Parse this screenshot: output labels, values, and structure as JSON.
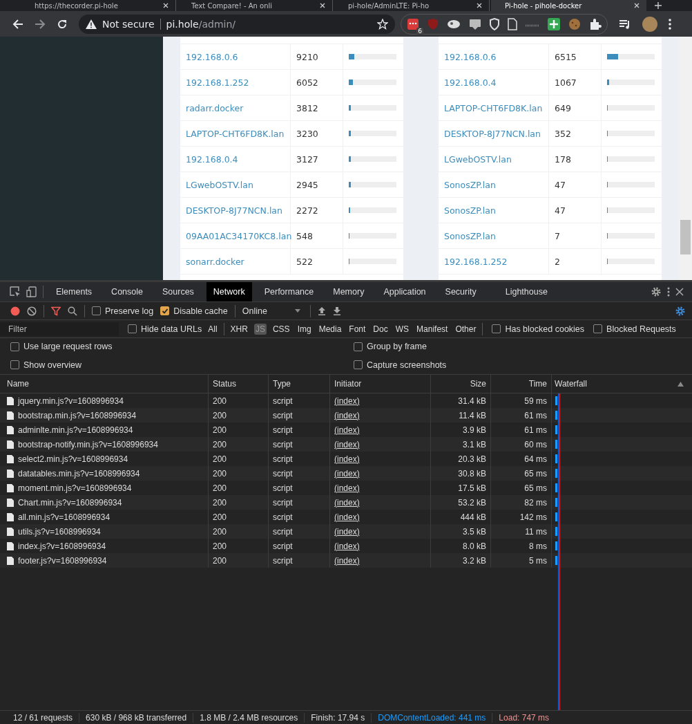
{
  "browser": {
    "tabs": [
      {
        "title": "https://thecorder.pi-hole",
        "selected": false
      },
      {
        "title": "Text Compare! - An onli",
        "selected": false
      },
      {
        "title": "pi-hole/AdminLTE: Pi-ho",
        "selected": false
      },
      {
        "title": "Pi-hole - pihole-docker",
        "selected": true
      }
    ],
    "address": {
      "security": "Not secure",
      "host": "pi.hole",
      "path": "/admin/"
    },
    "extension_badge": "6"
  },
  "page": {
    "tables": [
      {
        "rows": [
          {
            "host": "192.168.0.6",
            "count": "9210",
            "level": 0.12
          },
          {
            "host": "192.168.1.252",
            "count": "6052",
            "level": 0.08
          },
          {
            "host": "radarr.docker",
            "count": "3812",
            "level": 0.05
          },
          {
            "host": "LAPTOP-CHT6FD8K.lan",
            "count": "3230",
            "level": 0.045
          },
          {
            "host": "192.168.0.4",
            "count": "3127",
            "level": 0.045
          },
          {
            "host": "LGwebOSTV.lan",
            "count": "2945",
            "level": 0.04
          },
          {
            "host": "DESKTOP-8J77NCN.lan",
            "count": "2272",
            "level": 0.03
          },
          {
            "host": "09AA01AC34170KC8.lan",
            "count": "548",
            "level": 0.01
          },
          {
            "host": "sonarr.docker",
            "count": "522",
            "level": 0.01
          }
        ]
      },
      {
        "rows": [
          {
            "host": "192.168.0.6",
            "count": "6515",
            "level": 0.23
          },
          {
            "host": "192.168.0.4",
            "count": "1067",
            "level": 0.04
          },
          {
            "host": "LAPTOP-CHT6FD8K.lan",
            "count": "649",
            "level": 0.02
          },
          {
            "host": "DESKTOP-8J77NCN.lan",
            "count": "352",
            "level": 0.015
          },
          {
            "host": "LGwebOSTV.lan",
            "count": "178",
            "level": 0.01
          },
          {
            "host": "SonosZP.lan",
            "count": "47",
            "level": 0.005
          },
          {
            "host": "SonosZP.lan",
            "count": "47",
            "level": 0.005
          },
          {
            "host": "SonosZP.lan",
            "count": "7",
            "level": 0.002
          },
          {
            "host": "192.168.1.252",
            "count": "2",
            "level": 0.001
          }
        ]
      }
    ]
  },
  "devtools": {
    "tabs": [
      {
        "label": "Elements",
        "selected": false
      },
      {
        "label": "Console",
        "selected": false
      },
      {
        "label": "Sources",
        "selected": false
      },
      {
        "label": "Network",
        "selected": true
      },
      {
        "label": "Performance",
        "selected": false
      },
      {
        "label": "Memory",
        "selected": false
      },
      {
        "label": "Application",
        "selected": false
      },
      {
        "label": "Security",
        "selected": false
      },
      {
        "label": "Lighthouse",
        "selected": false
      }
    ],
    "toolbar": {
      "preserve_log": {
        "label": "Preserve log",
        "checked": false
      },
      "disable_cache": {
        "label": "Disable cache",
        "checked": true
      },
      "throttling": "Online"
    },
    "filter": {
      "placeholder": "Filter",
      "hide_data_urls": {
        "label": "Hide data URLs",
        "checked": false
      },
      "types": [
        {
          "label": "All",
          "selected": false
        },
        {
          "label": "XHR",
          "selected": false
        },
        {
          "label": "JS",
          "selected": true
        },
        {
          "label": "CSS",
          "selected": false
        },
        {
          "label": "Img",
          "selected": false
        },
        {
          "label": "Media",
          "selected": false
        },
        {
          "label": "Font",
          "selected": false
        },
        {
          "label": "Doc",
          "selected": false
        },
        {
          "label": "WS",
          "selected": false
        },
        {
          "label": "Manifest",
          "selected": false
        },
        {
          "label": "Other",
          "selected": false
        }
      ],
      "has_blocked_cookies": {
        "label": "Has blocked cookies",
        "checked": false
      },
      "blocked_requests": {
        "label": "Blocked Requests",
        "checked": false
      }
    },
    "options": [
      {
        "label": "Use large request rows",
        "checked": false
      },
      {
        "label": "Group by frame",
        "checked": false
      },
      {
        "label": "Show overview",
        "checked": false
      },
      {
        "label": "Capture screenshots",
        "checked": false
      }
    ],
    "columns": [
      "Name",
      "Status",
      "Type",
      "Initiator",
      "Size",
      "Time",
      "Waterfall"
    ],
    "rows": [
      {
        "name": "jquery.min.js?v=1608996934",
        "status": "200",
        "type": "script",
        "initiator": "(index)",
        "size": "31.4 kB",
        "time": "59 ms"
      },
      {
        "name": "bootstrap.min.js?v=1608996934",
        "status": "200",
        "type": "script",
        "initiator": "(index)",
        "size": "11.4 kB",
        "time": "61 ms"
      },
      {
        "name": "adminlte.min.js?v=1608996934",
        "status": "200",
        "type": "script",
        "initiator": "(index)",
        "size": "3.9 kB",
        "time": "61 ms"
      },
      {
        "name": "bootstrap-notify.min.js?v=1608996934",
        "status": "200",
        "type": "script",
        "initiator": "(index)",
        "size": "3.1 kB",
        "time": "60 ms"
      },
      {
        "name": "select2.min.js?v=1608996934",
        "status": "200",
        "type": "script",
        "initiator": "(index)",
        "size": "20.3 kB",
        "time": "64 ms"
      },
      {
        "name": "datatables.min.js?v=1608996934",
        "status": "200",
        "type": "script",
        "initiator": "(index)",
        "size": "30.8 kB",
        "time": "65 ms"
      },
      {
        "name": "moment.min.js?v=1608996934",
        "status": "200",
        "type": "script",
        "initiator": "(index)",
        "size": "17.5 kB",
        "time": "65 ms"
      },
      {
        "name": "Chart.min.js?v=1608996934",
        "status": "200",
        "type": "script",
        "initiator": "(index)",
        "size": "53.2 kB",
        "time": "82 ms"
      },
      {
        "name": "all.min.js?v=1608996934",
        "status": "200",
        "type": "script",
        "initiator": "(index)",
        "size": "444 kB",
        "time": "142 ms"
      },
      {
        "name": "utils.js?v=1608996934",
        "status": "200",
        "type": "script",
        "initiator": "(index)",
        "size": "3.5 kB",
        "time": "11 ms"
      },
      {
        "name": "index.js?v=1608996934",
        "status": "200",
        "type": "script",
        "initiator": "(index)",
        "size": "8.0 kB",
        "time": "8 ms"
      },
      {
        "name": "footer.js?v=1608996934",
        "status": "200",
        "type": "script",
        "initiator": "(index)",
        "size": "3.2 kB",
        "time": "5 ms"
      }
    ],
    "status_bar": [
      {
        "text": "12 / 61 requests",
        "kind": "plain"
      },
      {
        "text": "630 kB / 968 kB transferred",
        "kind": "plain"
      },
      {
        "text": "1.8 MB / 2.4 MB resources",
        "kind": "plain"
      },
      {
        "text": "Finish: 17.94 s",
        "kind": "plain"
      },
      {
        "text": "DOMContentLoaded: 441 ms",
        "kind": "dcl"
      },
      {
        "text": "Load: 747 ms",
        "kind": "load"
      }
    ]
  }
}
